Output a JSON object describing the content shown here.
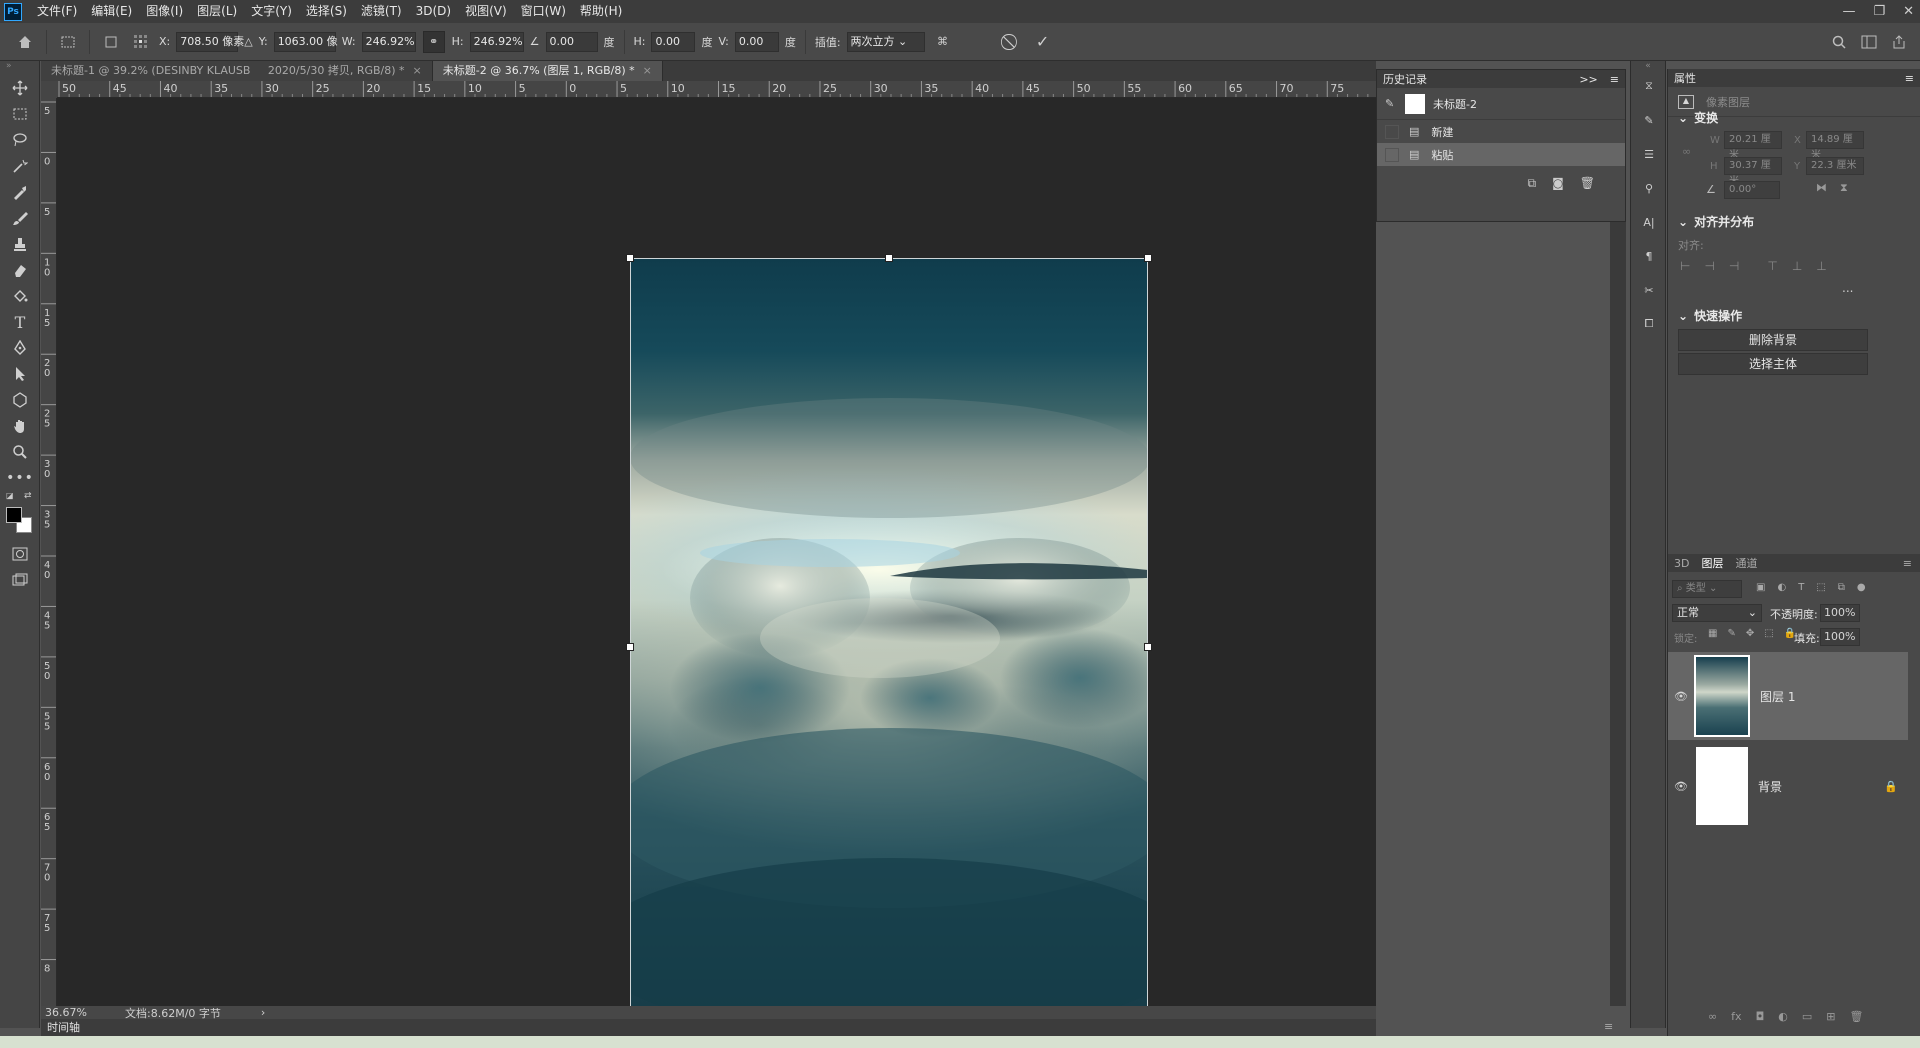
{
  "app": {
    "logo": "Ps"
  },
  "menu": [
    "文件(F)",
    "编辑(E)",
    "图像(I)",
    "图层(L)",
    "文字(Y)",
    "选择(S)",
    "滤镜(T)",
    "3D(D)",
    "视图(V)",
    "窗口(W)",
    "帮助(H)"
  ],
  "options": {
    "x_label": "X:",
    "x_value": "708.50 像素",
    "y_label": "Y:",
    "y_value": "1063.00 像",
    "w_label": "W:",
    "w_value": "246.92%",
    "h_label": "H:",
    "h_value": "246.92%",
    "angle_value": "0.00",
    "deg1": "度",
    "hskew_label": "H:",
    "hskew_value": "0.00",
    "deg2": "度",
    "vskew_label": "V:",
    "vskew_value": "0.00",
    "deg3": "度",
    "interp_label": "插值:",
    "interp_value": "两次立方"
  },
  "tabs": [
    {
      "label": "未标题-1 @ 39.2% (DESINBY KLAUSB",
      "active": false
    },
    {
      "label": "2020/5/30 拷贝, RGB/8) *",
      "active": false
    },
    {
      "label": "未标题-2 @ 36.7% (图层 1, RGB/8) *",
      "active": true
    }
  ],
  "hruler_labels": [
    "50",
    "45",
    "40",
    "35",
    "30",
    "25",
    "20",
    "15",
    "10",
    "5",
    "0",
    "5",
    "10",
    "15",
    "20",
    "25",
    "30",
    "35",
    "40",
    "45",
    "50",
    "55",
    "60",
    "65",
    "70",
    "75"
  ],
  "vruler_labels": [
    "5",
    "0",
    "5",
    "1 0",
    "1 5",
    "2 0",
    "2 5",
    "3 0",
    "3 5",
    "4 0",
    "4 5",
    "5 0",
    "5 5",
    "6 0",
    "6 5",
    "7 0",
    "7 5",
    "8"
  ],
  "status": {
    "zoom": "36.67%",
    "doc": "文档:8.62M/0 字节",
    "arrow": "›"
  },
  "timeline": {
    "label": "时间轴"
  },
  "history": {
    "title": "历史记录",
    "expand": ">>",
    "snapshot": "未标题-2",
    "items": [
      {
        "label": "新建",
        "selected": false
      },
      {
        "label": "粘贴",
        "selected": true
      }
    ]
  },
  "properties": {
    "title": "属性",
    "layer_type": "像素图层",
    "transform_title": "变换",
    "w_label": "W",
    "w_value": "20.21 厘米",
    "x_label": "X",
    "x_value": "14.89 厘米",
    "h_label": "H",
    "h_value": "30.37 厘米",
    "y_label": "Y",
    "y_value": "22.3 厘米",
    "angle_value": "0.00°",
    "align_title": "对齐并分布",
    "align_label": "对齐:",
    "more": "...",
    "quick_title": "快速操作",
    "remove_bg": "删除背景",
    "select_subject": "选择主体"
  },
  "layers_panel": {
    "tabs": [
      "3D",
      "图层",
      "通道"
    ],
    "active_tab": "图层",
    "search_placeholder": "类型",
    "blend_mode": "正常",
    "opacity_label": "不透明度:",
    "opacity_value": "100%",
    "lock_label": "锁定:",
    "fill_label": "填充:",
    "fill_value": "100%",
    "layers": [
      {
        "name": "图层 1",
        "visible": true,
        "locked": false,
        "selected": true
      },
      {
        "name": "背景",
        "visible": true,
        "locked": true,
        "selected": false
      }
    ]
  },
  "colors": {
    "bg": "#535353",
    "panel": "#494949",
    "canvas": "#282828",
    "accent": "#31a8ff"
  }
}
